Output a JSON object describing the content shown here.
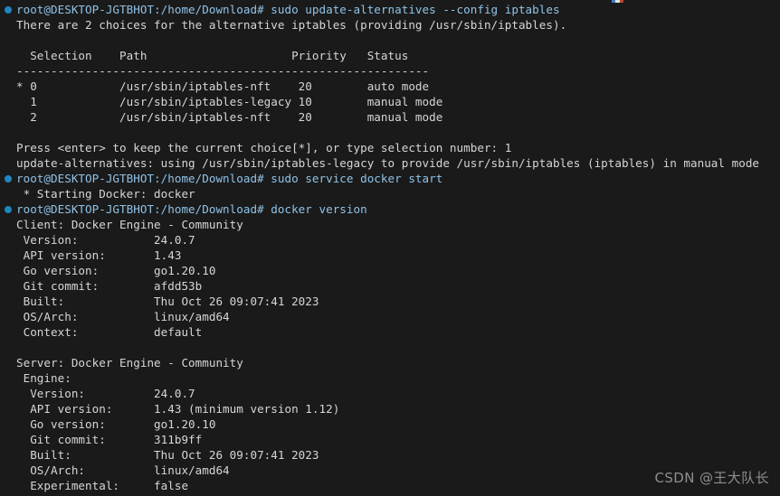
{
  "terminal": {
    "background_color": "#1a1a1a",
    "foreground_color": "#d6d6d6",
    "prompt_color": "#8fc3e8",
    "prompt_dot_color": "#1f86bf",
    "prompt_string": "root@DESKTOP-JGTBHOT:/home/Download#",
    "lines": [
      {
        "type": "prompt",
        "text": "root@DESKTOP-JGTBHOT:/home/Download# sudo update-alternatives --config iptables"
      },
      {
        "type": "output",
        "text": "There are 2 choices for the alternative iptables (providing /usr/sbin/iptables)."
      },
      {
        "type": "blank",
        "text": ""
      },
      {
        "type": "output",
        "text": "  Selection    Path                     Priority   Status"
      },
      {
        "type": "output",
        "text": "------------------------------------------------------------"
      },
      {
        "type": "output",
        "text": "* 0            /usr/sbin/iptables-nft    20        auto mode"
      },
      {
        "type": "output",
        "text": "  1            /usr/sbin/iptables-legacy 10        manual mode"
      },
      {
        "type": "output",
        "text": "  2            /usr/sbin/iptables-nft    20        manual mode"
      },
      {
        "type": "blank",
        "text": ""
      },
      {
        "type": "output",
        "text": "Press <enter> to keep the current choice[*], or type selection number: 1"
      },
      {
        "type": "output",
        "text": "update-alternatives: using /usr/sbin/iptables-legacy to provide /usr/sbin/iptables (iptables) in manual mode"
      },
      {
        "type": "prompt",
        "text": "root@DESKTOP-JGTBHOT:/home/Download# sudo service docker start"
      },
      {
        "type": "output",
        "text": " * Starting Docker: docker"
      },
      {
        "type": "prompt",
        "text": "root@DESKTOP-JGTBHOT:/home/Download# docker version"
      },
      {
        "type": "output",
        "text": "Client: Docker Engine - Community"
      },
      {
        "type": "output",
        "text": " Version:           24.0.7"
      },
      {
        "type": "output",
        "text": " API version:       1.43"
      },
      {
        "type": "output",
        "text": " Go version:        go1.20.10"
      },
      {
        "type": "output",
        "text": " Git commit:        afdd53b"
      },
      {
        "type": "output",
        "text": " Built:             Thu Oct 26 09:07:41 2023"
      },
      {
        "type": "output",
        "text": " OS/Arch:           linux/amd64"
      },
      {
        "type": "output",
        "text": " Context:           default"
      },
      {
        "type": "blank",
        "text": ""
      },
      {
        "type": "output",
        "text": "Server: Docker Engine - Community"
      },
      {
        "type": "output",
        "text": " Engine:"
      },
      {
        "type": "output",
        "text": "  Version:          24.0.7"
      },
      {
        "type": "output",
        "text": "  API version:      1.43 (minimum version 1.12)"
      },
      {
        "type": "output",
        "text": "  Go version:       go1.20.10"
      },
      {
        "type": "output",
        "text": "  Git commit:       311b9ff"
      },
      {
        "type": "output",
        "text": "  Built:            Thu Oct 26 09:07:41 2023"
      },
      {
        "type": "output",
        "text": "  OS/Arch:          linux/amd64"
      },
      {
        "type": "output",
        "text": "  Experimental:     false"
      }
    ],
    "commands": [
      "sudo update-alternatives --config iptables",
      "sudo service docker start",
      "docker version"
    ],
    "alternatives_table": {
      "headers": [
        "Selection",
        "Path",
        "Priority",
        "Status"
      ],
      "rows": [
        {
          "marker": "*",
          "selection": "0",
          "path": "/usr/sbin/iptables-nft",
          "priority": "20",
          "status": "auto mode"
        },
        {
          "marker": "",
          "selection": "1",
          "path": "/usr/sbin/iptables-legacy",
          "priority": "10",
          "status": "manual mode"
        },
        {
          "marker": "",
          "selection": "2",
          "path": "/usr/sbin/iptables-nft",
          "priority": "20",
          "status": "manual mode"
        }
      ],
      "choices_count": "2",
      "provides": "/usr/sbin/iptables",
      "user_input": "1"
    },
    "docker_client": {
      "title": "Client: Docker Engine - Community",
      "version": "24.0.7",
      "api_version": "1.43",
      "go_version": "go1.20.10",
      "git_commit": "afdd53b",
      "built": "Thu Oct 26 09:07:41 2023",
      "os_arch": "linux/amd64",
      "context": "default"
    },
    "docker_server": {
      "title": "Server: Docker Engine - Community",
      "engine_label": "Engine:",
      "version": "24.0.7",
      "api_version": "1.43 (minimum version 1.12)",
      "go_version": "go1.20.10",
      "git_commit": "311b9ff",
      "built": "Thu Oct 26 09:07:41 2023",
      "os_arch": "linux/amd64",
      "experimental": "false"
    }
  },
  "watermark": {
    "text": "CSDN @王大队长",
    "color": "#8e8e8e"
  }
}
